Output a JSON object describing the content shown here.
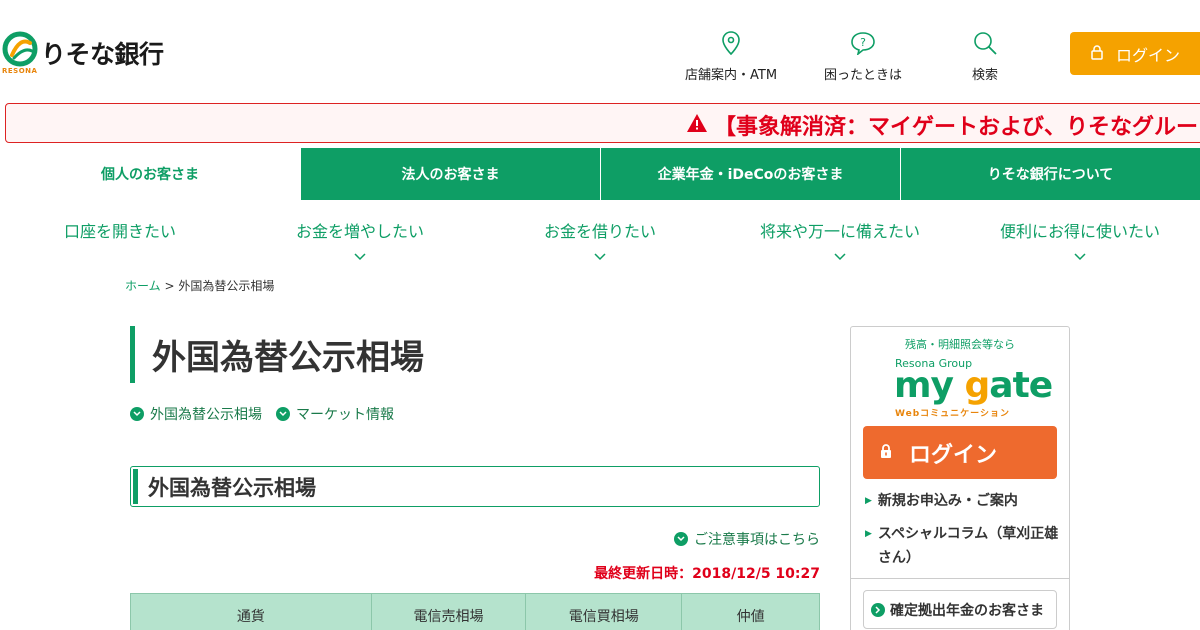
{
  "brand": {
    "name": "りそな銀行",
    "sub": "RESONA"
  },
  "header_nav": {
    "store": "店舗案内・ATM",
    "help": "困ったときは",
    "search": "検索",
    "login": "ログイン"
  },
  "alert": {
    "text": "【事象解消済：マイゲートおよび、りそなグルー"
  },
  "main_tabs": [
    "個人のお客さま",
    "法人のお客さま",
    "企業年金・iDeCoのお客さま",
    "りそな銀行について"
  ],
  "sub_nav": [
    "口座を開きたい",
    "お金を増やしたい",
    "お金を借りたい",
    "将来や万一に備えたい",
    "便利にお得に使いたい"
  ],
  "breadcrumb": {
    "home": "ホーム",
    "sep": ">",
    "current": "外国為替公示相場"
  },
  "page": {
    "title": "外国為替公示相場",
    "anchor_1": "外国為替公示相場",
    "anchor_2": "マーケット情報",
    "section_title": "外国為替公示相場",
    "notice_link": "ご注意事項はこちら",
    "updated": "最終更新日時：2018/12/5 10:27"
  },
  "table": {
    "headers": [
      "通貨",
      "電信売相場",
      "電信買相場",
      "仲値"
    ]
  },
  "sidebar": {
    "caption": "残高・明細照会等なら",
    "group": "Resona Group",
    "logo_a": "my ",
    "logo_g": "g",
    "logo_b": "ate",
    "logo_sub": "Webコミュニケーション",
    "login": "ログイン",
    "link_1": "新規お申込み・ご案内",
    "link_2": "スペシャルコラム（草刈正雄さん）",
    "pension": "確定拠出年金のお客さま"
  },
  "colors": {
    "brand_green": "#0e9e65",
    "orange": "#f5a200",
    "alert_red": "#e0001a",
    "login_orange": "#ee6a2e"
  }
}
